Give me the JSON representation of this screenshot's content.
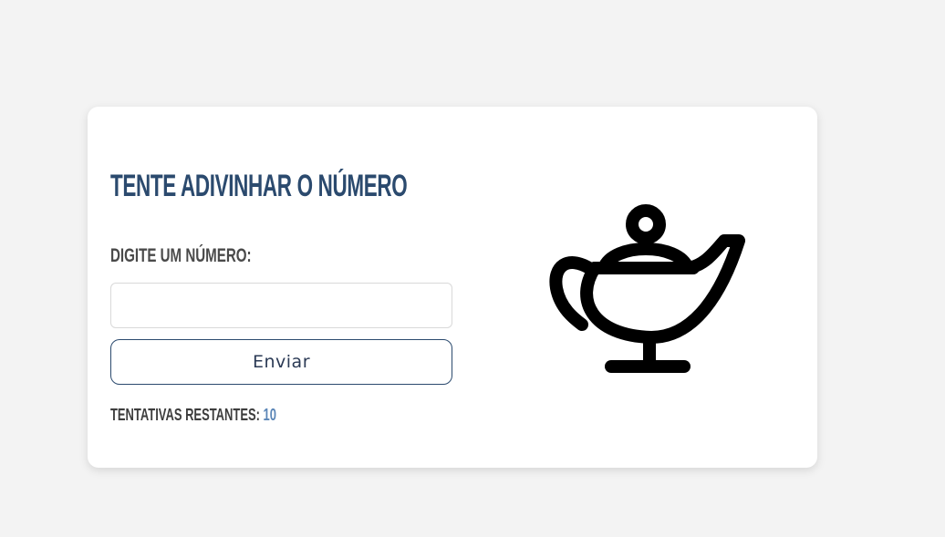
{
  "game": {
    "title": "Tente adivinhar o número",
    "input_label": "Digite um número:",
    "input_value": "",
    "input_placeholder": "",
    "submit_label": "Enviar",
    "attempts_label": "Tentativas restantes:",
    "attempts_remaining": "10",
    "illustration_icon": "magic-lamp-icon"
  },
  "colors": {
    "background": "#f3f3f3",
    "card": "#ffffff",
    "title": "#2b4a6e",
    "count_accent": "#5b86b7"
  }
}
